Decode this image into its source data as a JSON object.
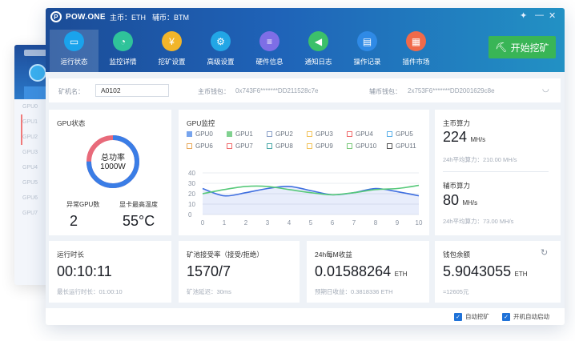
{
  "app": {
    "name": "POW.ONE",
    "main_coin": "主币：ETH",
    "aux_coin": "辅币：BTM",
    "logo_glyph": "P"
  },
  "window_controls": {
    "pin": "✦",
    "minimize": "—",
    "close": "✕"
  },
  "nav": [
    {
      "label": "运行状态",
      "icon": "monitor-icon",
      "color": "#1aa3ec",
      "glyph": "▭",
      "active": true
    },
    {
      "label": "监控详情",
      "icon": "gauge-icon",
      "color": "#2fc39a",
      "glyph": "◔"
    },
    {
      "label": "挖矿设置",
      "icon": "medal-icon",
      "color": "#f2b52a",
      "glyph": "¥"
    },
    {
      "label": "高级设置",
      "icon": "gear-icon",
      "color": "#22a6e6",
      "glyph": "⚙"
    },
    {
      "label": "硬件信息",
      "icon": "server-icon",
      "color": "#7e6ee6",
      "glyph": "≡"
    },
    {
      "label": "通知日志",
      "icon": "speaker-icon",
      "color": "#3cc06a",
      "glyph": "◀"
    },
    {
      "label": "操作记录",
      "icon": "document-icon",
      "color": "#2f8ae6",
      "glyph": "▤"
    },
    {
      "label": "插件市场",
      "icon": "grid-icon",
      "color": "#f06a4a",
      "glyph": "▦"
    }
  ],
  "start_button": {
    "label": "开始挖矿",
    "icon": "pickaxe-icon",
    "glyph": "⛏"
  },
  "info_strip": {
    "miner_label": "矿机名：",
    "miner_name": "A0102",
    "main_wallet_label": "主币钱包：",
    "main_wallet": "0x743F6*******DD211528c7e",
    "aux_wallet_label": "辅币钱包：",
    "aux_wallet": "2x753F6*******DD2001629c8e",
    "eye_glyph": "◡"
  },
  "gpu_status": {
    "title": "GPU状态",
    "ring_label": "总功率",
    "ring_value": "1000W",
    "ring_fraction": 0.75,
    "abnormal_label": "异常GPU数",
    "abnormal_value": "2",
    "temp_label": "显卡最高温度",
    "temp_value": "55°C"
  },
  "gpu_monitor": {
    "title": "GPU监控",
    "legend": [
      {
        "name": "GPU0",
        "color": "#4a86e8",
        "checked": true
      },
      {
        "name": "GPU1",
        "color": "#57c26b",
        "checked": true
      },
      {
        "name": "GPU2",
        "color": "#8aa0c8"
      },
      {
        "name": "GPU3",
        "color": "#f2c35a"
      },
      {
        "name": "GPU4",
        "color": "#ef6b6b"
      },
      {
        "name": "GPU5",
        "color": "#5ab0e8"
      },
      {
        "name": "GPU6",
        "color": "#e8a85a"
      },
      {
        "name": "GPU7",
        "color": "#ef6b6b"
      },
      {
        "name": "GPU8",
        "color": "#4aa8a8"
      },
      {
        "name": "GPU9",
        "color": "#f2c35a"
      },
      {
        "name": "GPU10",
        "color": "#7ac87a"
      },
      {
        "name": "GPU11",
        "color": "#555555"
      }
    ]
  },
  "chart_data": {
    "type": "line",
    "x": [
      0,
      1,
      2,
      3,
      4,
      5,
      6,
      7,
      8,
      9,
      10
    ],
    "xticks": [
      "0",
      "1",
      "2",
      "3",
      "4",
      "5",
      "6",
      "7",
      "8",
      "9",
      "10"
    ],
    "yticks": [
      "0",
      "10",
      "20",
      "30",
      "40"
    ],
    "ylim": [
      0,
      40
    ],
    "xlim": [
      0,
      10
    ],
    "grid": true,
    "series": [
      {
        "name": "GPU0",
        "color": "#3f6fe0",
        "area": true,
        "values": [
          25,
          18,
          21,
          25,
          27,
          23,
          19,
          21,
          25,
          22,
          18
        ]
      },
      {
        "name": "GPU1",
        "color": "#57c97a",
        "area": false,
        "values": [
          20,
          24,
          27,
          27,
          24,
          21,
          19,
          21,
          24,
          25,
          28
        ]
      }
    ]
  },
  "main_hashrate": {
    "title": "主币算力",
    "value": "224",
    "unit": "MH/s",
    "avg": "24h平均算力：210.00 MH/s"
  },
  "aux_hashrate": {
    "title": "辅币算力",
    "value": "80",
    "unit": "MH/s",
    "avg": "24h平均算力：73.00 MH/s"
  },
  "runtime": {
    "title": "运行时长",
    "value": "00:10:11",
    "sub": "最长运行时长：01:00:10"
  },
  "pool": {
    "title": "矿池接受率（接受/拒绝）",
    "value": "1570/7",
    "sub": "矿池延迟：30ms"
  },
  "income": {
    "title": "24h每M收益",
    "value": "0.01588264",
    "unit": "ETH",
    "sub": "预期日收益：0.3818336 ETH"
  },
  "wallet": {
    "title": "钱包余额",
    "value": "5.9043055",
    "unit": "ETH",
    "sub": "≈12605元",
    "refresh_glyph": "↻"
  },
  "footer": {
    "auto_mine": "自动挖矿",
    "auto_start": "开机自动启动",
    "check_glyph": "✓"
  },
  "ghost": {
    "rows": [
      "GPU0",
      "GPU1",
      "GPU2",
      "GPU3",
      "GPU4",
      "GPU5",
      "GPU6",
      "GPU7"
    ]
  }
}
